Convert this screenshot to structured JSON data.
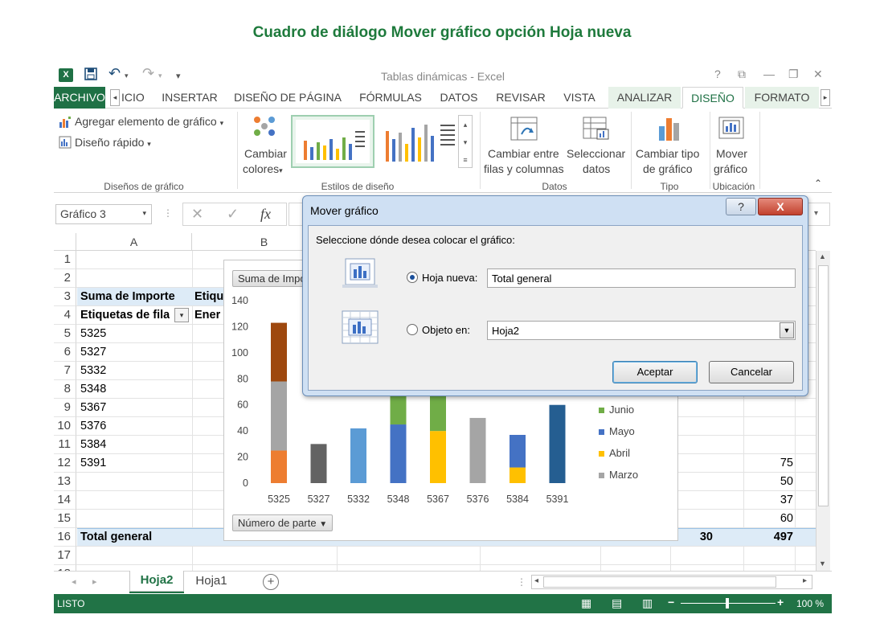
{
  "heading": "Cuadro de diálogo Mover gráfico opción Hoja nueva",
  "window": {
    "title": "Tablas dinámicas - Excel",
    "controls": [
      "?",
      "⧉",
      "—",
      "❐",
      "✕"
    ]
  },
  "tabs": [
    {
      "label": "ARCHIVO"
    },
    {
      "label": "ICIO"
    },
    {
      "label": "INSERTAR"
    },
    {
      "label": "DISEÑO DE PÁGINA"
    },
    {
      "label": "FÓRMULAS"
    },
    {
      "label": "DATOS"
    },
    {
      "label": "REVISAR"
    },
    {
      "label": "VISTA"
    },
    {
      "label": "ANALIZAR"
    },
    {
      "label": "DISEÑO"
    },
    {
      "label": "FORMATO"
    }
  ],
  "ribbon": {
    "add_element": "Agregar elemento de gráfico",
    "quick_layout": "Diseño rápido",
    "change_colors_1": "Cambiar",
    "change_colors_2": "colores",
    "switch_1": "Cambiar entre",
    "switch_2": "filas y columnas",
    "select_1": "Seleccionar",
    "select_2": "datos",
    "charttype_1": "Cambiar tipo",
    "charttype_2": "de gráfico",
    "move_1": "Mover",
    "move_2": "gráfico",
    "groups": [
      "Diseños de gráfico",
      "Estilos de diseño",
      "Datos",
      "Tipo",
      "Ubicación"
    ]
  },
  "formula_bar": {
    "name_box": "Gráfico 3",
    "fx": "fx"
  },
  "grid": {
    "columns": [
      "A",
      "B"
    ],
    "rows": [
      "1",
      "2",
      "3",
      "4",
      "5",
      "6",
      "7",
      "8",
      "9",
      "10",
      "11",
      "12",
      "13",
      "14",
      "15",
      "16",
      "17",
      "18"
    ],
    "a3": "Suma de Importe",
    "b3": "Etiqu",
    "a4": "Etiquetas de fila",
    "b4": "Ener",
    "parts": [
      "5325",
      "5327",
      "5332",
      "5348",
      "5367",
      "5376",
      "5384",
      "5391"
    ],
    "total_label": "Total general",
    "right_values": [
      "75",
      "50",
      "37",
      "60"
    ],
    "total_30": "30",
    "total_497": "497"
  },
  "chart": {
    "field_button_value": "Suma de Impo",
    "field_button_axis": "Número de parte",
    "legend": [
      {
        "name": "Junio",
        "color": "#70ad47"
      },
      {
        "name": "Mayo",
        "color": "#4472c4"
      },
      {
        "name": "Abril",
        "color": "#ffc000"
      },
      {
        "name": "Marzo",
        "color": "#a5a5a5"
      }
    ]
  },
  "chart_data": {
    "type": "bar",
    "stacked": true,
    "categories": [
      "5325",
      "5327",
      "5332",
      "5348",
      "5367",
      "5376",
      "5384",
      "5391"
    ],
    "ylim": [
      0,
      140
    ],
    "yticks": [
      0,
      20,
      40,
      60,
      80,
      100,
      120,
      140
    ],
    "series": [
      {
        "color": "#ed7d31",
        "values": [
          25,
          0,
          0,
          0,
          0,
          0,
          0,
          0
        ]
      },
      {
        "name": "Marzo",
        "color": "#a5a5a5",
        "values": [
          53,
          0,
          0,
          0,
          0,
          50,
          0,
          0
        ]
      },
      {
        "color": "#9e480e",
        "values": [
          45,
          0,
          0,
          0,
          0,
          0,
          0,
          0
        ]
      },
      {
        "color": "#636363",
        "values": [
          0,
          30,
          0,
          0,
          0,
          0,
          0,
          0
        ]
      },
      {
        "color": "#5b9bd5",
        "values": [
          0,
          0,
          42,
          0,
          0,
          0,
          0,
          0
        ]
      },
      {
        "name": "Abril",
        "color": "#ffc000",
        "values": [
          0,
          0,
          0,
          0,
          40,
          0,
          12,
          0
        ]
      },
      {
        "name": "Mayo",
        "color": "#4472c4",
        "values": [
          0,
          0,
          0,
          45,
          0,
          0,
          25,
          0
        ]
      },
      {
        "name": "Junio",
        "color": "#70ad47",
        "values": [
          0,
          0,
          0,
          30,
          40,
          0,
          0,
          0
        ]
      },
      {
        "color": "#255e91",
        "values": [
          0,
          0,
          0,
          0,
          0,
          0,
          0,
          60
        ]
      }
    ]
  },
  "sheets": {
    "active": "Hoja2",
    "other": "Hoja1",
    "add": "+"
  },
  "status": {
    "mode": "LISTO",
    "zoom": "100 %"
  },
  "dialog": {
    "title": "Mover gráfico",
    "help": "?",
    "close": "X",
    "prompt": "Seleccione dónde desea colocar el gráfico:",
    "new_sheet_label": "Hoja nueva:",
    "new_sheet_value": "Total general",
    "object_label": "Objeto en:",
    "object_value": "Hoja2",
    "ok": "Aceptar",
    "cancel": "Cancelar"
  }
}
